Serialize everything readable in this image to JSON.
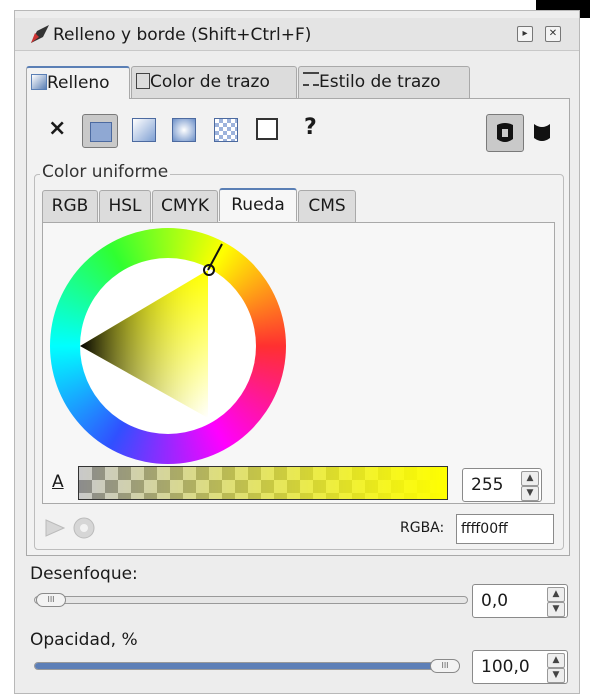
{
  "window": {
    "title": "Relleno y borde (Shift+Ctrl+F)",
    "btn_menu": "▸",
    "btn_close": "✕"
  },
  "tabs": [
    {
      "label": "Relleno",
      "icon": "fill-swatch-icon",
      "active": true
    },
    {
      "label": "Color de trazo",
      "icon": "stroke-swatch-icon",
      "active": false
    },
    {
      "label": "Estilo de trazo",
      "icon": "stroke-style-icon",
      "active": false
    }
  ],
  "fill_types": {
    "none_label": "×",
    "unset_label": "?",
    "icons": [
      "no-paint-icon",
      "flat-color-icon",
      "linear-gradient-icon",
      "radial-gradient-icon",
      "pattern-icon",
      "swatch-icon",
      "unset-paint-icon"
    ]
  },
  "fill_rule_icons": [
    "evenodd-fill-icon",
    "nonzero-fill-icon"
  ],
  "color_section": {
    "label": "Color uniforme"
  },
  "color_tabs": [
    "RGB",
    "HSL",
    "CMYK",
    "Rueda",
    "CMS"
  ],
  "active_color_tab": "Rueda",
  "alpha": {
    "label": "A",
    "value": "255"
  },
  "rgba": {
    "label": "RGBA:",
    "value": "ffff00ff"
  },
  "blur": {
    "label": "Desenfoque:",
    "value": "0,0",
    "level": 0
  },
  "opacity": {
    "label": "Opacidad, %",
    "value": "100,0",
    "level": 1.0
  },
  "colors": {
    "selected": "#ffff00",
    "accent": "#5d7fb7"
  }
}
